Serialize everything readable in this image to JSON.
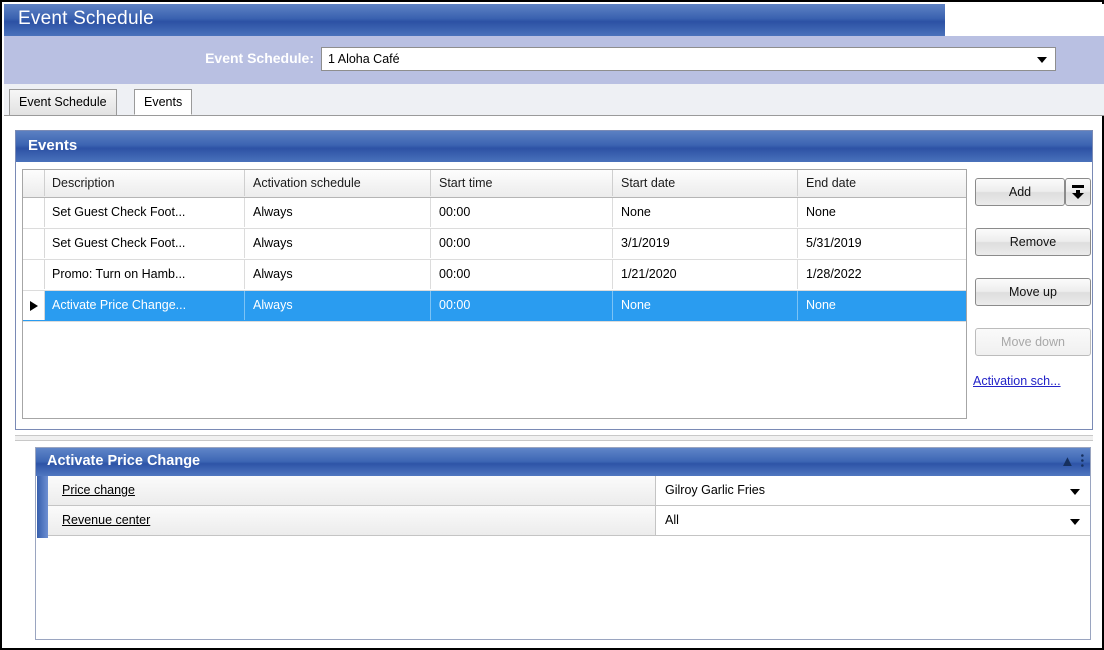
{
  "window": {
    "title": "Event Schedule"
  },
  "selector": {
    "label": "Event Schedule:",
    "value": "1 Aloha Café",
    "arrow_icon": "chevron-down-icon"
  },
  "tabs": [
    {
      "label": "Event Schedule",
      "active": false
    },
    {
      "label": "Events",
      "active": true
    }
  ],
  "events_panel": {
    "header": "Events",
    "grid": {
      "columns": [
        "Description",
        "Activation schedule",
        "Start time",
        "Start date",
        "End date"
      ],
      "rows": [
        {
          "selected": false,
          "indicator": false,
          "cells": [
            "Set Guest Check Foot...",
            "Always",
            "00:00",
            "None",
            "None"
          ]
        },
        {
          "selected": false,
          "indicator": false,
          "cells": [
            "Set Guest Check Foot...",
            "Always",
            "00:00",
            "3/1/2019",
            "5/31/2019"
          ]
        },
        {
          "selected": false,
          "indicator": false,
          "cells": [
            "Promo: Turn on Hamb...",
            "Always",
            "00:00",
            "1/21/2020",
            "1/28/2022"
          ]
        },
        {
          "selected": true,
          "indicator": true,
          "cells": [
            "Activate Price Change...",
            "Always",
            "00:00",
            "None",
            "None"
          ]
        }
      ]
    },
    "buttons": {
      "add": "Add",
      "add_dropdown_icon": "insert-down-arrow-icon",
      "remove": "Remove",
      "move_up": "Move up",
      "move_down": "Move down",
      "move_down_disabled": true
    },
    "link": "Activation sch..."
  },
  "property_panel": {
    "header": "Activate Price Change",
    "collapse_icon": "chevrons-up-icon",
    "rows": [
      {
        "label": "Price change",
        "value": "Gilroy Garlic Fries",
        "arrow_icon": "chevron-down-icon"
      },
      {
        "label": "Revenue center",
        "value": "All",
        "arrow_icon": "chevron-down-icon"
      }
    ]
  },
  "colors": {
    "title_blue": "#2c51a4",
    "band_lavender": "#b9c0e2",
    "selection_blue": "#2a9cf0",
    "link_blue": "#2323c8"
  }
}
